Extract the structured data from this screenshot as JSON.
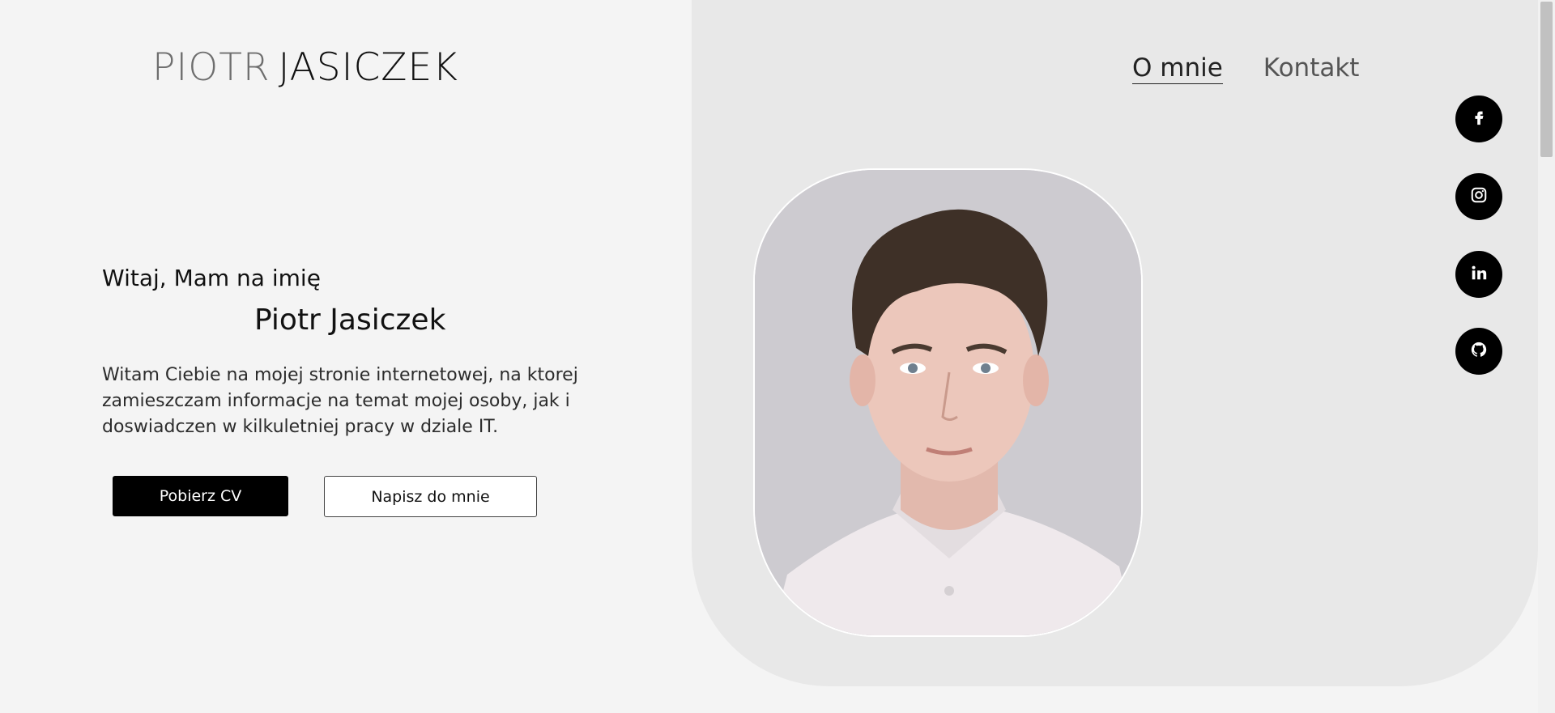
{
  "logo": {
    "first": "PIOTR",
    "last": "JASICZEK"
  },
  "nav": {
    "items": [
      {
        "label": "O mnie"
      },
      {
        "label": "Kontakt"
      }
    ]
  },
  "hero": {
    "greeting": "Witaj, Mam na imię",
    "name": "Piotr Jasiczek",
    "description": "Witam Ciebie na mojej stronie internetowej, na ktorej zamieszczam informacje na temat mojej osoby, jak i doswiadczen w kilkuletniej pracy w dziale IT.",
    "buttons": {
      "primary": "Pobierz CV",
      "secondary": "Napisz do mnie"
    }
  },
  "social": [
    {
      "icon": "facebook-icon"
    },
    {
      "icon": "instagram-icon"
    },
    {
      "icon": "linkedin-icon"
    },
    {
      "icon": "github-icon"
    }
  ],
  "colors": {
    "background": "#f4f4f4",
    "panel": "#e8e8e8",
    "accent": "#000000"
  }
}
